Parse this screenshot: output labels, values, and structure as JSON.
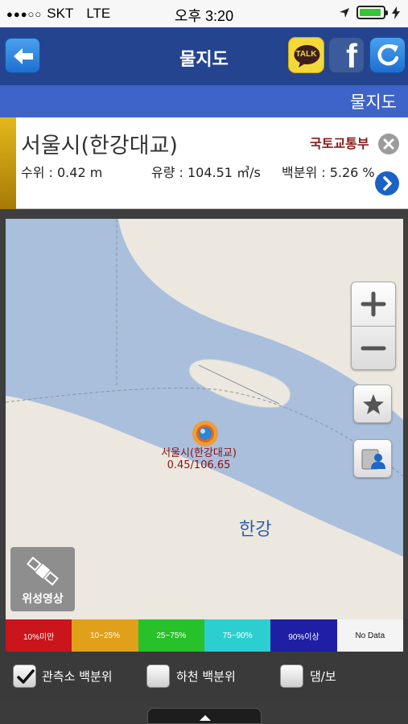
{
  "status_bar": {
    "signal": "●●●○○",
    "carrier": "SKT",
    "network": "LTE",
    "time": "오후 3:20"
  },
  "nav": {
    "title": "물지도",
    "back_icon": "arrow-left-icon",
    "talk_label": "TALK",
    "facebook_label": "f",
    "refresh_icon": "refresh-icon"
  },
  "sub_header": {
    "title": "물지도"
  },
  "station": {
    "name": "서울시(한강대교)",
    "agency": "국토교통부",
    "water_level": "수위 : 0.42 m",
    "flow": "유량 : 104.51 ㎥/s",
    "percentile": "백분위 : 5.26 %"
  },
  "map": {
    "marker_name": "서울시(한강대교)",
    "marker_values": "0.45/106.65",
    "river_name": "한강",
    "satellite_label": "위성영상",
    "zoom_in": "+",
    "zoom_out": "−"
  },
  "legend": [
    {
      "label": "10%미만",
      "color": "#c9151b"
    },
    {
      "label": "10~25%",
      "color": "#e0a019"
    },
    {
      "label": "25~75%",
      "color": "#27c12a"
    },
    {
      "label": "75~90%",
      "color": "#2ccfd0"
    },
    {
      "label": "90%이상",
      "color": "#1f1fa6"
    },
    {
      "label": "No Data",
      "color": "#f4f4f4"
    }
  ],
  "filters": [
    {
      "label": "관측소 백분위",
      "checked": true
    },
    {
      "label": "하천 백분위",
      "checked": false
    },
    {
      "label": "댐/보",
      "checked": false
    }
  ],
  "colors": {
    "nav": "#24448f",
    "sub_header": "#3f64c9",
    "river": "#a9bfdc",
    "land": "#ece8df"
  }
}
